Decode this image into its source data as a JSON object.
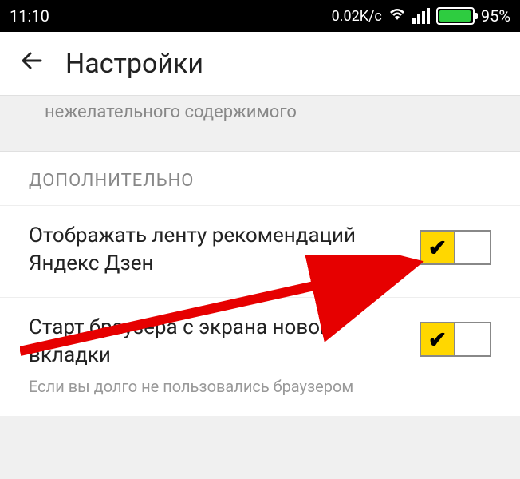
{
  "status": {
    "time": "11:10",
    "speed": "0.02K/c",
    "battery_pct": "95%"
  },
  "header": {
    "title": "Настройки"
  },
  "prev_setting_tail": "нежелательного содержимого",
  "section": {
    "header": "ДОПОЛНИТЕЛЬНО",
    "items": [
      {
        "title": "Отображать ленту рекомендаций Яндекс Дзен",
        "checked": true
      },
      {
        "title": "Старт браузера с экрана новой вкладки",
        "sub": "Если вы долго не пользовались браузером",
        "checked": true
      }
    ]
  }
}
